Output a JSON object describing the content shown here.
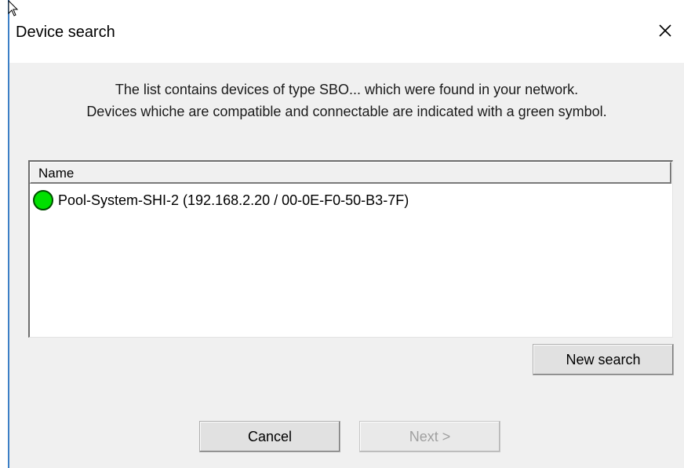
{
  "window": {
    "title": "Device search",
    "close_glyph": "✕",
    "border_color": "#3c7fc6"
  },
  "description": {
    "line1": "The list contains devices of type SBO... which were found in your network.",
    "line2": "Devices whiche are compatible and connectable are indicated with a green symbol."
  },
  "device_list": {
    "header": "Name",
    "items": [
      {
        "label": "Pool-System-SHI-2 (192.168.2.20 / 00-0E-F0-50-B3-7F)",
        "status": "compatible",
        "status_color": "#00e000",
        "icon": "green-circle-icon"
      }
    ]
  },
  "buttons": {
    "new_search": "New search",
    "cancel": "Cancel",
    "next": "Next >"
  }
}
